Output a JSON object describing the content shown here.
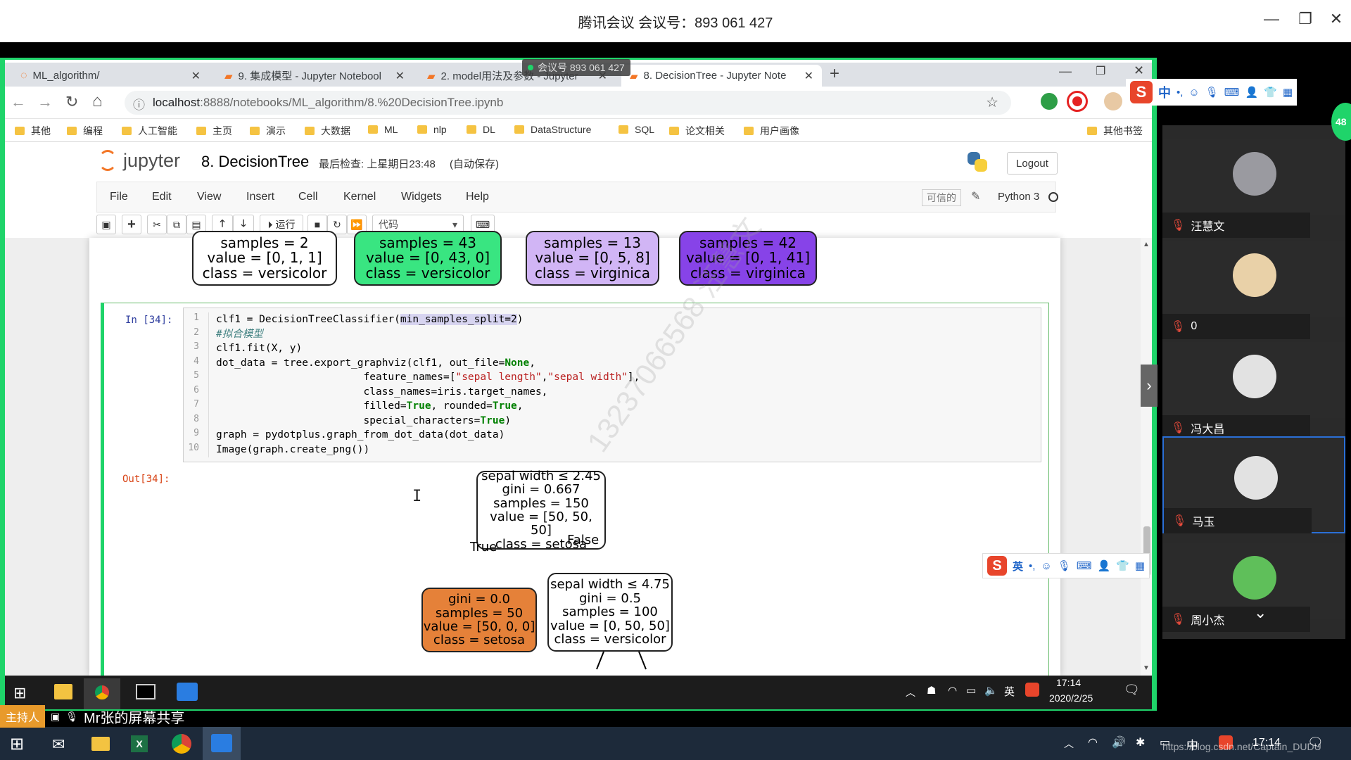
{
  "meeting": {
    "title": "腾讯会议 会议号：893 061 427",
    "overlay_id": "会议号 893 061 427"
  },
  "browser": {
    "tabs": [
      {
        "label": "ML_algorithm/"
      },
      {
        "label": "9. 集成模型 - Jupyter Notebool"
      },
      {
        "label": "2. model用法及参数 - Jupyter"
      },
      {
        "label": "8. DecisionTree - Jupyter Note"
      }
    ],
    "url_host": "localhost",
    "url_path": ":8888/notebooks/ML_algorithm/8.%20DecisionTree.ipynb",
    "bookmarks": [
      "其他",
      "编程",
      "人工智能",
      "主页",
      "演示",
      "大数据",
      "ML",
      "nlp",
      "DL",
      "DataStructure",
      "SQL",
      "论文相关",
      "用户画像"
    ],
    "other_bookmarks": "其他书签"
  },
  "jupyter": {
    "logo": "jupyter",
    "notebook_name": "8. DecisionTree",
    "checkpoint": "最后检查: 上星期日23:48",
    "autosave": "(自动保存)",
    "logout": "Logout",
    "menu": [
      "File",
      "Edit",
      "View",
      "Insert",
      "Cell",
      "Kernel",
      "Widgets",
      "Help"
    ],
    "trusted": "可信的",
    "kernel": "Python 3",
    "run_label": "运行",
    "cell_type": "代码"
  },
  "top_tree_nodes": [
    {
      "lines": [
        "samples = 2",
        "value = [0, 1, 1]",
        "class = versicolor"
      ],
      "fill": "#ffffff"
    },
    {
      "lines": [
        "samples = 43",
        "value = [0, 43, 0]",
        "class = versicolor"
      ],
      "fill": "#39e581"
    },
    {
      "lines": [
        "samples = 13",
        "value = [0, 5, 8]",
        "class = virginica"
      ],
      "fill": "#d1b5f5"
    },
    {
      "lines": [
        "samples = 42",
        "value = [0, 1, 41]",
        "class = virginica"
      ],
      "fill": "#8743e8"
    }
  ],
  "cell": {
    "in_prompt": "In  [34]:",
    "out_prompt": "Out[34]:",
    "line_numbers": [
      "1",
      "2",
      "3",
      "4",
      "5",
      "6",
      "7",
      "8",
      "9",
      "10"
    ]
  },
  "tree": {
    "root": [
      "sepal width ≤ 2.45",
      "gini = 0.667",
      "samples = 150",
      "value = [50, 50, 50]",
      "class = setosa"
    ],
    "left": [
      "gini = 0.0",
      "samples = 50",
      "value = [50, 0, 0]",
      "class = setosa"
    ],
    "right": [
      "sepal width ≤ 4.75",
      "gini = 0.5",
      "samples = 100",
      "value = [0, 50, 50]",
      "class = versicolor"
    ],
    "true_label": "True",
    "false_label": "False"
  },
  "watermark": "13237066568 汪慧文",
  "participants": [
    {
      "name": "汪慧文"
    },
    {
      "name": "0"
    },
    {
      "name": "冯大昌"
    },
    {
      "name": "马玉"
    },
    {
      "name": "周小杰"
    }
  ],
  "participant_count": "48",
  "taskbar_inner": {
    "time": "17:14",
    "date": "2020/2/25",
    "lang": "英"
  },
  "presenter": {
    "badge": "主持人",
    "label": "Mr张的屏幕共享"
  },
  "taskbar_outer": {
    "time": "17:14",
    "lang": "中",
    "url_watermark": "https://blog.csdn.net/Captain_DUDU"
  },
  "ime": {
    "lang_top": "中",
    "lang_bottom": "英"
  }
}
